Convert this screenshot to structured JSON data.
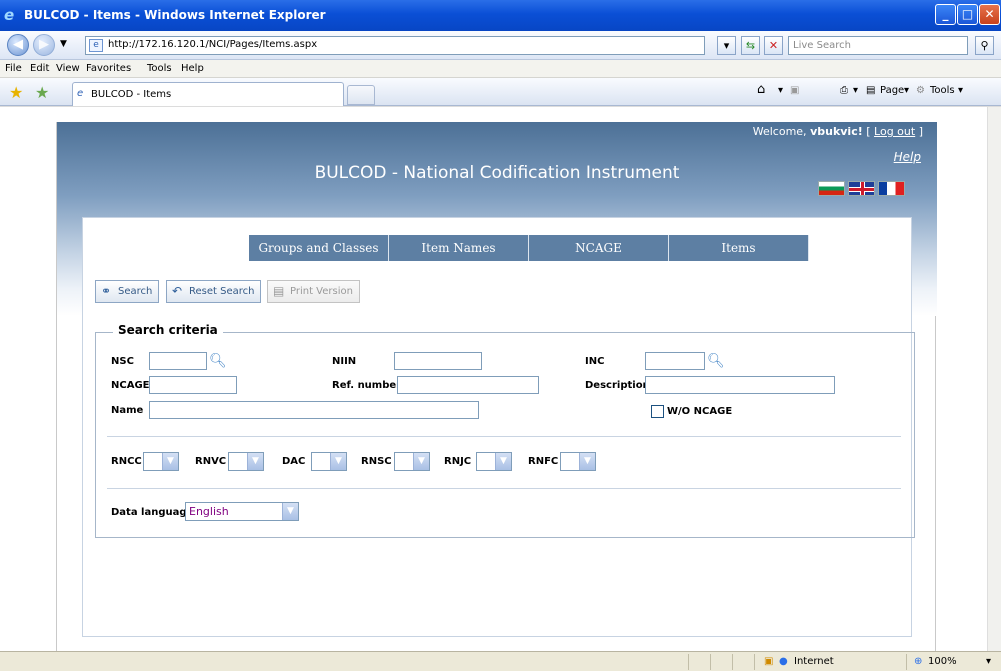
{
  "window": {
    "title": "BULCOD - Items - Windows Internet Explorer",
    "controls": {
      "minimize": "_",
      "maximize": "□",
      "close": "✕"
    }
  },
  "addressbar": {
    "url": "http://172.16.120.1/NCI/Pages/Items.aspx",
    "search_placeholder": "Live Search"
  },
  "menu": [
    "File",
    "Edit",
    "View",
    "Favorites",
    "Tools",
    "Help"
  ],
  "browser_tab": {
    "title": "BULCOD - Items"
  },
  "command_bar": {
    "page_label": "Page",
    "tools_label": "Tools"
  },
  "page": {
    "welcome_prefix": "Welcome,",
    "username": "vbukvic!",
    "logout_label": "Log out",
    "help_label": "Help",
    "app_title": "BULCOD - National Codification Instrument"
  },
  "nav_tabs": [
    "Groups and Classes",
    "Item Names",
    "NCAGE",
    "Items"
  ],
  "actions": {
    "search": "Search",
    "reset": "Reset Search",
    "print": "Print Version"
  },
  "criteria": {
    "legend": "Search criteria",
    "nsc": "NSC",
    "niin": "NIIN",
    "inc": "INC",
    "ncage": "NCAGE",
    "ref_number": "Ref. number",
    "description": "Description",
    "name": "Name",
    "wo_ncage": "W/O NCAGE",
    "codes": [
      "RNCC",
      "RNVC",
      "DAC",
      "RNSC",
      "RNJC",
      "RNFC"
    ],
    "data_language_label": "Data language",
    "data_language_value": "English"
  },
  "statusbar": {
    "zone": "Internet",
    "zoom": "100%"
  },
  "colors": {
    "titlebar": "#0a4fd6",
    "nav_tab": "#5d7fa3",
    "link": "#355a86"
  }
}
